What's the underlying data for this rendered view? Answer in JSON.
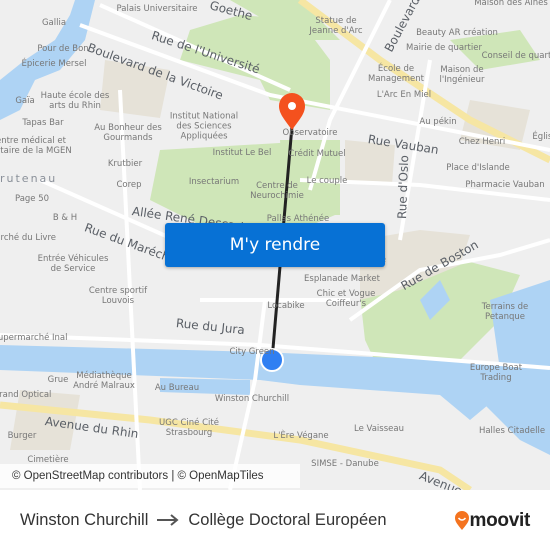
{
  "map": {
    "districts": [
      {
        "name": "rutenau"
      }
    ],
    "roads": [
      {
        "name": "Boulevard de la Victoire"
      },
      {
        "name": "Rue de l'Université"
      },
      {
        "name": "Rue Vauban"
      },
      {
        "name": "Boulevard"
      },
      {
        "name": "Rue d'Oslo"
      },
      {
        "name": "Rue de Boston"
      },
      {
        "name": "Allée René Descartes"
      },
      {
        "name": "Rue du Maréchal"
      },
      {
        "name": "Rue du Jura"
      },
      {
        "name": "Avenue du Rhin"
      },
      {
        "name": "Avenue"
      },
      {
        "name": "Goethe"
      }
    ],
    "places": [
      {
        "name": "Palais Universitaire"
      },
      {
        "name": "Gallia"
      },
      {
        "name": "Pour de Bon"
      },
      {
        "name": "Épicerie Mersel"
      },
      {
        "name": "Gaïa"
      },
      {
        "name": "Haute école des arts du Rhin"
      },
      {
        "name": "Tapas Bar"
      },
      {
        "name": "Centre médical et dentaire de la MGEN"
      },
      {
        "name": "Au Bonheur des Gourmands"
      },
      {
        "name": "Institut National des Sciences Appliquées"
      },
      {
        "name": "Institut Le Bel"
      },
      {
        "name": "Krutbier"
      },
      {
        "name": "Corep"
      },
      {
        "name": "Insectarium"
      },
      {
        "name": "Page 50"
      },
      {
        "name": "B & H"
      },
      {
        "name": "Marché du Livre"
      },
      {
        "name": "Entrée Véhicules de Service"
      },
      {
        "name": "Centre sportif Louvois"
      },
      {
        "name": "Centre de Neurochimie"
      },
      {
        "name": "Pallas Athénée"
      },
      {
        "name": "Statue de Jeanne d'Arc"
      },
      {
        "name": "Beauty AR création"
      },
      {
        "name": "Mairie de quartier"
      },
      {
        "name": "Maison des Aînés"
      },
      {
        "name": "Conseil de quartier"
      },
      {
        "name": "École de Management"
      },
      {
        "name": "Maison de l'Ingénieur"
      },
      {
        "name": "L'Arc En Miel"
      },
      {
        "name": "Au pékin"
      },
      {
        "name": "Chez Henri"
      },
      {
        "name": "Observatoire"
      },
      {
        "name": "Crédit Mutuel"
      },
      {
        "name": "Le couple"
      },
      {
        "name": "Place d'Islande"
      },
      {
        "name": "Pharmacie Vauban"
      },
      {
        "name": "Esplanade Market"
      },
      {
        "name": "Chic et Vogue Coiffeur's"
      },
      {
        "name": "Locabike"
      },
      {
        "name": "Terrains de Petanque"
      },
      {
        "name": "Europe Boat Trading"
      },
      {
        "name": "Supermarché Inal"
      },
      {
        "name": "City Green"
      },
      {
        "name": "Médiathèque André Malraux"
      },
      {
        "name": "Grue"
      },
      {
        "name": "Au Bureau"
      },
      {
        "name": "Winston Churchill"
      },
      {
        "name": "Grand Optical"
      },
      {
        "name": "UGC Ciné Cité Strasbourg"
      },
      {
        "name": "Burger"
      },
      {
        "name": "Cimetière"
      },
      {
        "name": "L'Ère Végane"
      },
      {
        "name": "Le Vaisseau"
      },
      {
        "name": "Halles Citadelle"
      },
      {
        "name": "SIMSE - Danube"
      },
      {
        "name": "Église"
      },
      {
        "name": "Esplanade"
      }
    ],
    "origin_marker": {
      "icon": "origin-dot-icon",
      "color": "#2f7ff2"
    },
    "destination_marker": {
      "icon": "destination-pin-icon",
      "color": "#f4511e"
    },
    "route_color": "#222222",
    "cta_label": "M'y rendre",
    "cta_color": "#0771d5",
    "attribution": "© OpenStreetMap contributors | © OpenMapTiles"
  },
  "footer": {
    "from": "Winston Churchill",
    "to": "Collège Doctoral Européen",
    "arrow_icon": "arrow-right-icon",
    "brand": "moovit",
    "brand_color": "#f4731f"
  }
}
